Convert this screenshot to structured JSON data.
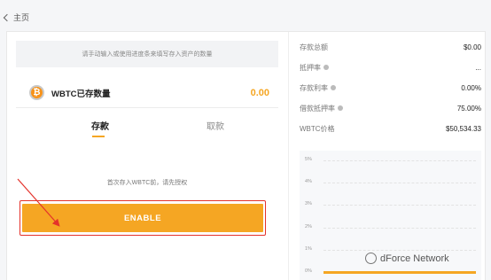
{
  "nav": {
    "back_label": "主页"
  },
  "deposit_panel": {
    "hint": "请手动输入或使用进度条来填写存入资产的数量",
    "asset_label": "WBTC已存数量",
    "asset_value": "0.00",
    "tabs": [
      "存款",
      "取款"
    ],
    "active_tab": "存款",
    "auth_note": "首次存入WBTC前，请先授权",
    "enable_label": "ENABLE"
  },
  "stats": [
    {
      "label": "存款总额",
      "value": "$0.00",
      "info": false
    },
    {
      "label": "抵押率",
      "value": "...",
      "info": true
    },
    {
      "label": "存款利率",
      "value": "0.00%",
      "info": true
    },
    {
      "label": "借款抵押率",
      "value": "75.00%",
      "info": true
    },
    {
      "label": "WBTC价格",
      "value": "$50,534.33",
      "info": false
    }
  ],
  "chart_data": {
    "type": "bar",
    "yticks": [
      "5%",
      "4%",
      "3%",
      "2%",
      "1%",
      "0%"
    ],
    "ylim": [
      0,
      5
    ],
    "values": [
      0
    ]
  },
  "watermark": "dForce Network",
  "colors": {
    "accent": "#f5a623",
    "highlight": "#e4322b"
  }
}
